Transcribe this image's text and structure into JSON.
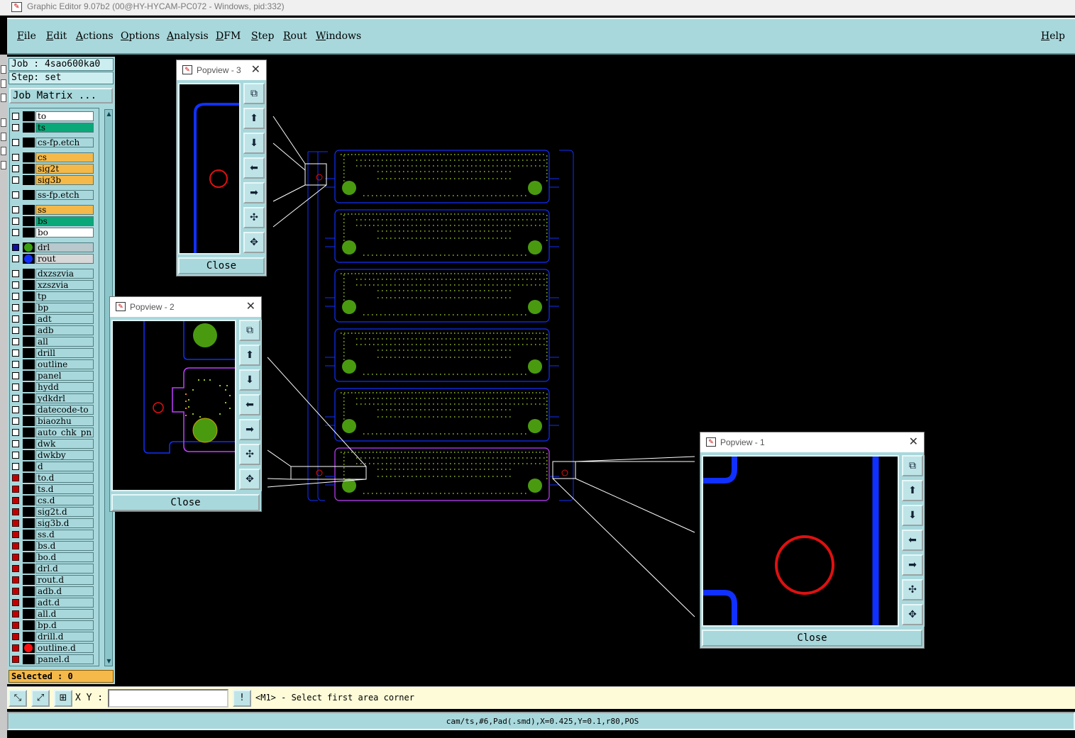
{
  "window": {
    "title": "Graphic Editor 9.07b2 (00@HY-HYCAM-PC072 - Windows, pid:332)",
    "app_icon": "graphic-editor-icon"
  },
  "menu": {
    "items": [
      "File",
      "Edit",
      "Actions",
      "Options",
      "Analysis",
      "DFM",
      "Step",
      "Rout",
      "Windows"
    ],
    "help": "Help"
  },
  "left_panel": {
    "job": "Job : 4sao600ka0",
    "step": "Step: set",
    "job_matrix": "Job Matrix ...",
    "selected": "Selected : 0",
    "layers": [
      {
        "name": "to",
        "color": "#ffffff",
        "box": "white"
      },
      {
        "name": "ts",
        "color": "#0aa878",
        "box": "white"
      },
      {
        "name": "cs-fp.etch",
        "color": "#a8d8dc",
        "box": "white"
      },
      {
        "name": "cs",
        "color": "#f5b94a",
        "box": "white"
      },
      {
        "name": "sig2t",
        "color": "#f5b94a",
        "box": "white"
      },
      {
        "name": "sig3b",
        "color": "#f5b94a",
        "box": "white"
      },
      {
        "name": "ss-fp.etch",
        "color": "#a8d8dc",
        "box": "white"
      },
      {
        "name": "ss",
        "color": "#f5b94a",
        "box": "white"
      },
      {
        "name": "bs",
        "color": "#0aa878",
        "box": "white"
      },
      {
        "name": "bo",
        "color": "#ffffff",
        "box": "white"
      },
      {
        "name": "drl",
        "color": "#b8c8cc",
        "box": "blue",
        "dot": "#3aa010"
      },
      {
        "name": "rout",
        "color": "#d8d8d8",
        "box": "white",
        "dot": "#1030ff"
      },
      {
        "name": "dxzszvia",
        "color": "#a8d8dc",
        "box": "white"
      },
      {
        "name": "xzszvia",
        "color": "#a8d8dc",
        "box": "white"
      },
      {
        "name": "tp",
        "color": "#a8d8dc",
        "box": "white"
      },
      {
        "name": "bp",
        "color": "#a8d8dc",
        "box": "white"
      },
      {
        "name": "adt",
        "color": "#a8d8dc",
        "box": "white"
      },
      {
        "name": "adb",
        "color": "#a8d8dc",
        "box": "white"
      },
      {
        "name": "all",
        "color": "#a8d8dc",
        "box": "white"
      },
      {
        "name": "drill",
        "color": "#a8d8dc",
        "box": "white"
      },
      {
        "name": "outline",
        "color": "#a8d8dc",
        "box": "white"
      },
      {
        "name": "panel",
        "color": "#a8d8dc",
        "box": "white"
      },
      {
        "name": "hydd",
        "color": "#a8d8dc",
        "box": "white"
      },
      {
        "name": "ydkdrl",
        "color": "#a8d8dc",
        "box": "white"
      },
      {
        "name": "datecode-to",
        "color": "#a8d8dc",
        "box": "white"
      },
      {
        "name": "biaozhu",
        "color": "#a8d8dc",
        "box": "white"
      },
      {
        "name": "auto_chk_pn",
        "color": "#a8d8dc",
        "box": "white"
      },
      {
        "name": "dwk",
        "color": "#a8d8dc",
        "box": "white"
      },
      {
        "name": "dwkby",
        "color": "#a8d8dc",
        "box": "white"
      },
      {
        "name": "d",
        "color": "#a8d8dc",
        "box": "white"
      },
      {
        "name": "to.d",
        "color": "#a8d8dc",
        "box": "red"
      },
      {
        "name": "ts.d",
        "color": "#a8d8dc",
        "box": "red"
      },
      {
        "name": "cs.d",
        "color": "#a8d8dc",
        "box": "red"
      },
      {
        "name": "sig2t.d",
        "color": "#a8d8dc",
        "box": "red"
      },
      {
        "name": "sig3b.d",
        "color": "#a8d8dc",
        "box": "red"
      },
      {
        "name": "ss.d",
        "color": "#a8d8dc",
        "box": "red"
      },
      {
        "name": "bs.d",
        "color": "#a8d8dc",
        "box": "red"
      },
      {
        "name": "bo.d",
        "color": "#a8d8dc",
        "box": "red"
      },
      {
        "name": "drl.d",
        "color": "#a8d8dc",
        "box": "red"
      },
      {
        "name": "rout.d",
        "color": "#a8d8dc",
        "box": "red"
      },
      {
        "name": "adb.d",
        "color": "#a8d8dc",
        "box": "red"
      },
      {
        "name": "adt.d",
        "color": "#a8d8dc",
        "box": "red"
      },
      {
        "name": "all.d",
        "color": "#a8d8dc",
        "box": "red"
      },
      {
        "name": "bp.d",
        "color": "#a8d8dc",
        "box": "red"
      },
      {
        "name": "drill.d",
        "color": "#a8d8dc",
        "box": "red"
      },
      {
        "name": "outline.d",
        "color": "#a8d8dc",
        "box": "red",
        "dot": "#ff1010"
      },
      {
        "name": "panel.d",
        "color": "#a8d8dc",
        "box": "red"
      }
    ]
  },
  "popviews": {
    "p3": {
      "title": "Popview - 3",
      "close": "Close"
    },
    "p2": {
      "title": "Popview - 2",
      "close": "Close"
    },
    "p1": {
      "title": "Popview - 1",
      "close": "Close"
    }
  },
  "cmdbar": {
    "xy_label": "X Y :",
    "input_value": "",
    "message": "<M1> - Select first area corner"
  },
  "status": "cam/ts,#6,Pad(.smd),X=0.425,Y=0.1,r80,POS",
  "colors": {
    "panel_bg": "#a8d8dc",
    "rout": "#1030ff",
    "pad": "#4a9a10",
    "drill_circle": "#e01010",
    "smd_dots": "#9ac820",
    "selected_outline": "#c040ff"
  }
}
